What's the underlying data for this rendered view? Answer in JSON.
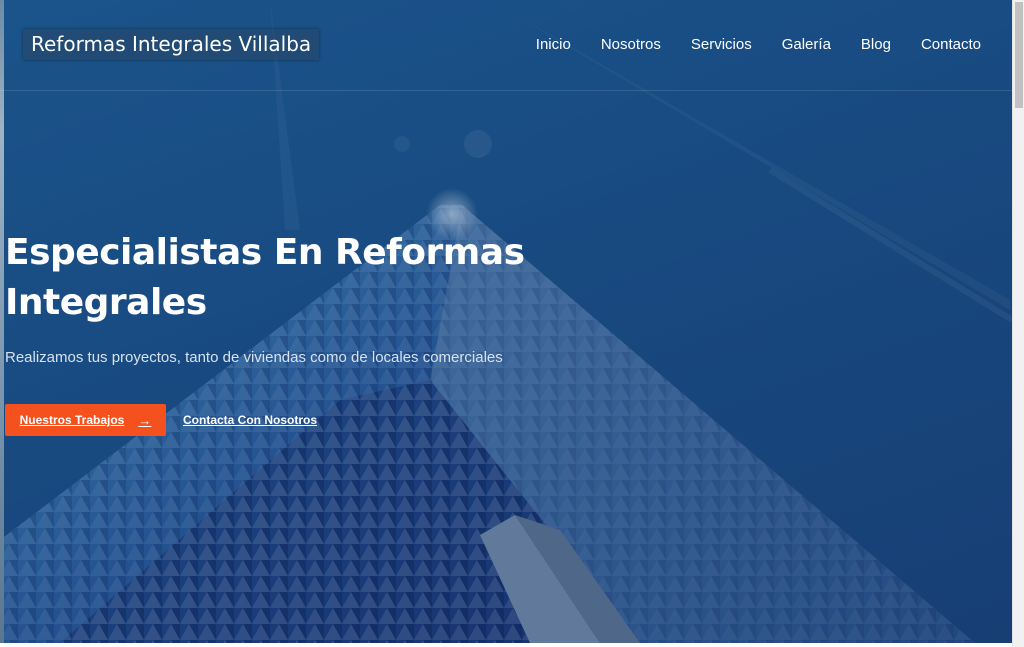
{
  "header": {
    "logo_text": "Reformas Integrales Villalba",
    "nav": [
      {
        "label": "Inicio"
      },
      {
        "label": "Nosotros"
      },
      {
        "label": "Servicios"
      },
      {
        "label": "Galería"
      },
      {
        "label": "Blog"
      },
      {
        "label": "Contacto"
      }
    ]
  },
  "hero": {
    "title": "Especialistas En Reformas Integrales",
    "subtitle": "Realizamos tus proyectos, tanto de viviendas como de locales comerciales",
    "primary_button": {
      "label": "Nuestros Trabajos",
      "icon": "arrow-right-icon"
    },
    "secondary_button": {
      "label": "Contacta Con Nosotros"
    }
  },
  "colors": {
    "accent": "#f4511e",
    "overlay": "#1b4f82",
    "text": "#ffffff"
  }
}
